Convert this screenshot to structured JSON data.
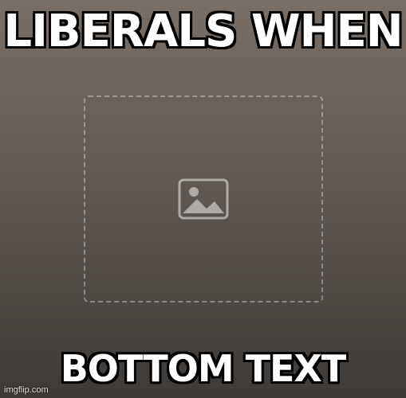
{
  "meme": {
    "top_text": "LIBERALS WHEN",
    "bottom_text": "BOTTOM TEXT",
    "watermark": "imgflip.com"
  }
}
